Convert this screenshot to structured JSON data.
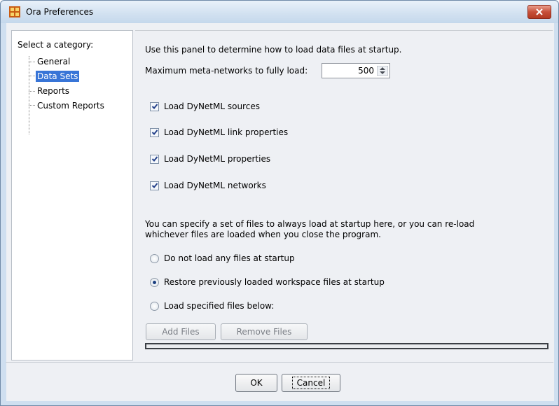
{
  "window": {
    "title": "Ora Preferences",
    "app_icon": "ora-grid-icon",
    "close_icon": "close-icon"
  },
  "sidebar": {
    "title": "Select a category:",
    "items": [
      {
        "label": "General",
        "selected": false
      },
      {
        "label": "Data Sets",
        "selected": true
      },
      {
        "label": "Reports",
        "selected": false
      },
      {
        "label": "Custom Reports",
        "selected": false
      }
    ]
  },
  "panel": {
    "intro": "Use this panel to determine how to load data files at startup.",
    "max_label": "Maximum meta-networks to fully load:",
    "max_value": "500",
    "checkboxes": [
      {
        "label": "Load DyNetML sources",
        "checked": true
      },
      {
        "label": "Load DyNetML link properties",
        "checked": true
      },
      {
        "label": "Load DyNetML properties",
        "checked": true
      },
      {
        "label": "Load DyNetML networks",
        "checked": true
      }
    ],
    "note_line1": "You can specify a set of files to always load at startup here, or you can re-load",
    "note_line2": "whichever files are loaded when you close the program.",
    "radios": [
      {
        "label": "Do not load any files at startup",
        "selected": false
      },
      {
        "label": "Restore previously loaded workspace files at startup",
        "selected": true
      },
      {
        "label": "Load specified files below:",
        "selected": false
      }
    ],
    "add_files": "Add Files",
    "remove_files": "Remove Files"
  },
  "footer": {
    "ok": "OK",
    "cancel": "Cancel"
  },
  "colors": {
    "selection": "#3875d7",
    "close": "#c7503a",
    "titlebar": "#d3e2f1"
  }
}
